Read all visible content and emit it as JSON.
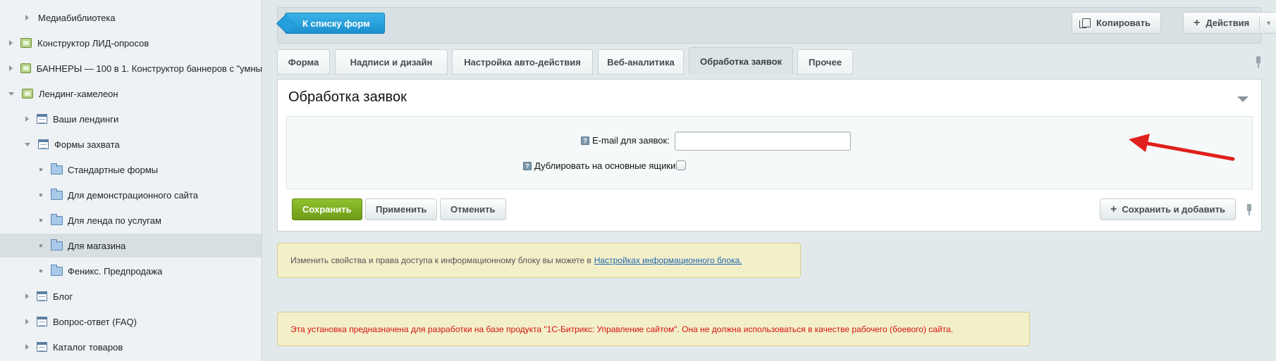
{
  "sidebar": {
    "items": [
      {
        "label": "Медиабиблиотека",
        "icon": "none",
        "expander": "collapsed"
      },
      {
        "label": "Конструктор ЛИД-опросов",
        "icon": "module-icon",
        "expander": "collapsed"
      },
      {
        "label": "БАННЕРЫ — 100 в 1. Конструктор баннеров с \"умны",
        "icon": "module-icon",
        "expander": "collapsed"
      },
      {
        "label": "Лендинг-хамелеон",
        "icon": "module-icon",
        "expander": "expanded"
      },
      {
        "label": "Ваши лендинги",
        "icon": "list-icon",
        "expander": "collapsed"
      },
      {
        "label": "Формы захвата",
        "icon": "list-icon",
        "expander": "expanded"
      },
      {
        "label": "Стандартные формы",
        "icon": "folder-icon",
        "expander": "bullet"
      },
      {
        "label": "Для демонстрационного сайта",
        "icon": "folder-icon",
        "expander": "bullet"
      },
      {
        "label": "Для ленда по услугам",
        "icon": "folder-icon",
        "expander": "bullet"
      },
      {
        "label": "Для магазина",
        "icon": "folder-icon",
        "expander": "bullet",
        "active": true
      },
      {
        "label": "Феникс. Предпродажа",
        "icon": "folder-icon",
        "expander": "bullet"
      },
      {
        "label": "Блог",
        "icon": "list-icon",
        "expander": "collapsed"
      },
      {
        "label": "Вопрос-ответ (FAQ)",
        "icon": "list-icon",
        "expander": "collapsed"
      },
      {
        "label": "Каталог товаров",
        "icon": "list-icon",
        "expander": "collapsed"
      }
    ]
  },
  "toolbar": {
    "back_label": "К списку форм",
    "copy_label": "Копировать",
    "actions_label": "Действия"
  },
  "tabs": [
    {
      "label": "Форма"
    },
    {
      "label": "Надписи и дизайн"
    },
    {
      "label": "Настройка авто-действия"
    },
    {
      "label": "Веб-аналитика"
    },
    {
      "label": "Обработка заявок",
      "active": true
    },
    {
      "label": "Прочее"
    }
  ],
  "panel": {
    "title": "Обработка заявок",
    "email_label": "E-mail для заявок:",
    "email_value": "",
    "duplicate_label": "Дублировать на основные ящики:",
    "duplicate_checked": false,
    "help_glyph": "?"
  },
  "buttons": {
    "save": "Сохранить",
    "apply": "Применить",
    "cancel": "Отменить",
    "save_add": "Сохранить и добавить"
  },
  "notes": {
    "info_text": "Изменить свойства и права доступа к информационному блоку вы можете в",
    "info_link": "Настройках информационного блока.",
    "warning_text": "Эта установка предназначена для разработки на базе продукта \"1С-Битрикс: Управление сайтом\". Она не должна использоваться в качестве рабочего (боевого) сайта."
  },
  "colors": {
    "accent_blue": "#1a91cf",
    "save_green": "#6e9c17",
    "warning_red": "#d3130f",
    "annotation_arrow": "#e0201c"
  }
}
